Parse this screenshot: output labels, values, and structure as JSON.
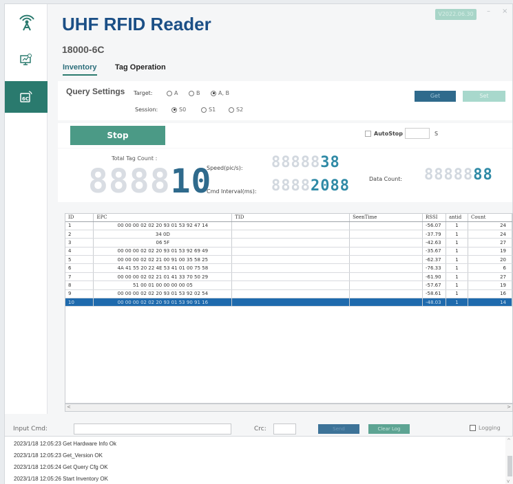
{
  "app": {
    "title": "UHF RFID Reader",
    "version": "V2022.06.30",
    "minimize": "–",
    "close": "×"
  },
  "sidebar": {
    "logo_icon": "rfid-antenna-icon",
    "items": [
      {
        "icon": "monitor-settings-icon"
      },
      {
        "icon": "6c-tag-icon"
      }
    ]
  },
  "protocol": "18000-6C",
  "tabs": [
    {
      "label": "Inventory"
    },
    {
      "label": "Tag Operation"
    }
  ],
  "query": {
    "title": "Query Settings",
    "target_label": "Target:",
    "target_options": [
      "A",
      "B",
      "A, B"
    ],
    "target_selected": "A, B",
    "session_label": "Session:",
    "session_options": [
      "S0",
      "S1",
      "S2"
    ],
    "session_selected": "S0",
    "get_label": "Get",
    "set_label": "Set"
  },
  "control": {
    "stop_label": "Stop",
    "autostop_label": "AutoStop",
    "autostop_unit": "S"
  },
  "counts": {
    "total_label": "Total Tag Count :",
    "total_value": "10",
    "speed_label": "Speed(pic/s):",
    "speed_value": "38",
    "interval_label": "Cmd Interval(ms):",
    "interval_value": "2088",
    "data_count_label": "Data Count:",
    "data_count_value": "88"
  },
  "table": {
    "headers": [
      "ID",
      "EPC",
      "TID",
      "SeenTime",
      "RSSI",
      "antid",
      "Count"
    ],
    "rows": [
      [
        "1",
        "00 00 00 02 02 20 93 01 53 92 47 14",
        "",
        "",
        "-56.07",
        "1",
        "24"
      ],
      [
        "2",
        "34 0D",
        "",
        "",
        "-37.79",
        "1",
        "24"
      ],
      [
        "3",
        "06 5F",
        "",
        "",
        "-42.63",
        "1",
        "27"
      ],
      [
        "4",
        "00 00 00 02 02 20 93 01 53 92 69 49",
        "",
        "",
        "-35.67",
        "1",
        "19"
      ],
      [
        "5",
        "00 00 00 02 02 21 00 91 00 35 58 25",
        "",
        "",
        "-62.37",
        "1",
        "20"
      ],
      [
        "6",
        "4A 41 55 20 22 4E 53 41 01 00 75 58",
        "",
        "",
        "-76.33",
        "1",
        "6"
      ],
      [
        "7",
        "00 00 00 02 02 21 01 41 33 70 50 29",
        "",
        "",
        "-61.90",
        "1",
        "27"
      ],
      [
        "8",
        "51 00 01 00 00 00 00 05",
        "",
        "",
        "-57.67",
        "1",
        "19"
      ],
      [
        "9",
        "00 00 00 02 02 20 93 01 53 92 02 54",
        "",
        "",
        "-58.61",
        "1",
        "16"
      ],
      [
        "10",
        "00 00 00 02 02 20 93 01 53 90 91 16",
        "",
        "",
        "-48.03",
        "1",
        "14"
      ]
    ],
    "selected_row": 10
  },
  "command": {
    "input_label": "Input Cmd:",
    "crc_label": "Crc:",
    "send_label": "Send",
    "clear_label": "Clear Log",
    "logging_label": "Logging"
  },
  "log": [
    "2023/1/18 12:05:23 Get Hardware Info Ok",
    "2023/1/18 12:05:23 Get_Version OK",
    "2023/1/18 12:05:24 Get Query Cfg OK",
    "2023/1/18 12:05:26 Start Inventory OK"
  ]
}
